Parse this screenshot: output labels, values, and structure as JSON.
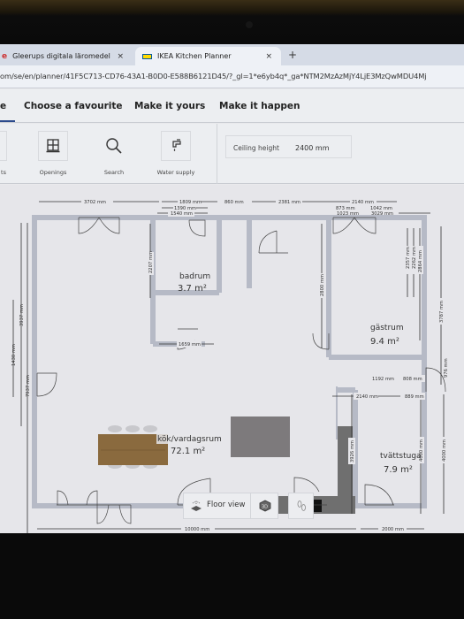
{
  "browser": {
    "tabs": [
      {
        "label": "Gleerups digitala läromedel",
        "favicon": "e",
        "active": false
      },
      {
        "label": "IKEA Kitchen Planner",
        "favicon": "ikea-logo",
        "active": true
      }
    ],
    "close_glyph": "×",
    "new_tab_glyph": "+",
    "url": "om/se/en/planner/41F5C713-CD76-43A1-B0D0-E588B6121D45/?_gl=1*e6yb4q*_ga*NTM2MzAzMjY4LjE3MzQwMDU4Mj"
  },
  "steps": [
    {
      "label": "e",
      "active": true
    },
    {
      "label": "Choose a favourite",
      "active": false
    },
    {
      "label": "Make it yours",
      "active": false
    },
    {
      "label": "Make it happen",
      "active": false
    }
  ],
  "toolbar": {
    "tools": [
      {
        "label": "ts",
        "icon": "rooms-icon"
      },
      {
        "label": "Openings",
        "icon": "window-icon"
      },
      {
        "label": "Search",
        "icon": "search-icon"
      },
      {
        "label": "Water supply",
        "icon": "faucet-icon"
      }
    ],
    "ceiling_label": "Ceiling height",
    "ceiling_value": "2400 mm"
  },
  "rooms": [
    {
      "name": "badrum",
      "area": "3.7 m²"
    },
    {
      "name": "gästrum",
      "area": "9.4 m²"
    },
    {
      "name": "kök/vardagsrum",
      "area": "72.1 m²"
    },
    {
      "name": "tvättstuga",
      "area": "7.9 m²"
    }
  ],
  "dimensions": {
    "top": [
      "3702 mm",
      "1809 mm",
      "1390 mm",
      "1540 mm",
      "860 mm",
      "2381 mm",
      "2140 mm",
      "873 mm",
      "1042 mm",
      "1023 mm",
      "3029 mm"
    ],
    "left": [
      "3937 mm",
      "1430 mm",
      "7937 mm"
    ],
    "badrum": [
      "2207 mm",
      "1659 mm"
    ],
    "hall": [
      "2800 mm"
    ],
    "gastrum": [
      "2357 mm",
      "2262 mm",
      "2864 mm",
      "3787 mm",
      "976 mm",
      "1192 mm",
      "808 mm"
    ],
    "tvatt": [
      "2140 mm",
      "889 mm",
      "3926 mm",
      "4000 mm",
      "4000 mm"
    ],
    "bottom": [
      "10000 mm",
      "2000 mm"
    ]
  },
  "view": {
    "floor_view_label": "Floor view",
    "floor_view_icon": "floor-view-icon",
    "view_3d_icon": "3d-view-icon",
    "footprints_icon": "footprints-icon"
  }
}
